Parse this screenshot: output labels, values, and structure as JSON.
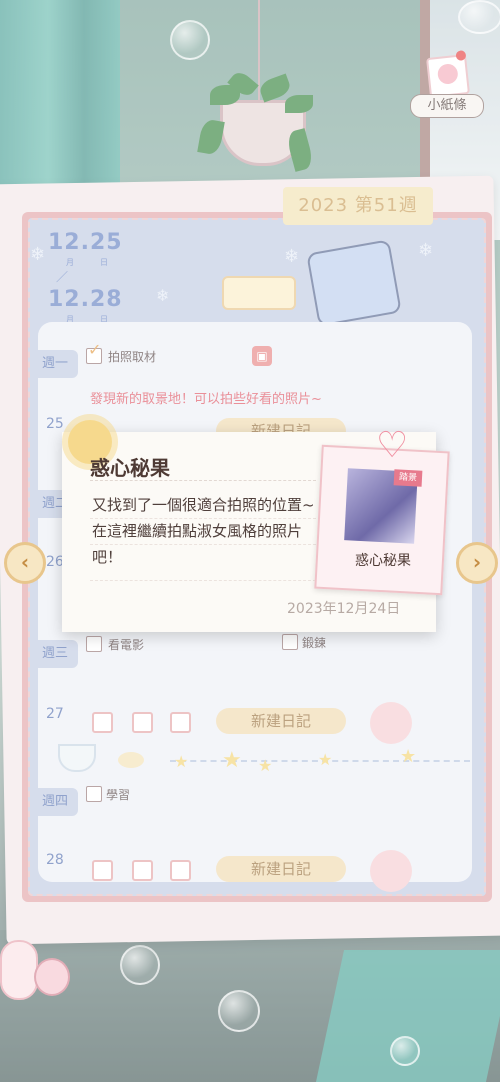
{
  "notes_button": {
    "label": "小紙條"
  },
  "week_tab": "2023 第51週",
  "date_range": {
    "start": "12.25",
    "start_month": "月",
    "start_day": "日",
    "separator": "／",
    "end": "12.28",
    "end_month": "月",
    "end_day": "日"
  },
  "days": [
    {
      "label": "週一",
      "num": "25",
      "tasks": [
        {
          "text": "拍照取材",
          "checked": true
        }
      ],
      "diary_text": "發現新的取景地！可以拍些好看的照片~",
      "new_button": "新建日記"
    },
    {
      "label": "週二",
      "num": "26"
    },
    {
      "label": "週三",
      "num": "27",
      "tasks": [
        {
          "text": "看電影",
          "checked": false
        },
        {
          "text": "鍛鍊",
          "checked": false
        }
      ],
      "new_button": "新建日記"
    },
    {
      "label": "週四",
      "num": "28",
      "tasks": [
        {
          "text": "學習",
          "checked": false
        }
      ],
      "new_button": "新建日記"
    }
  ],
  "popup": {
    "title": "惑心秘果",
    "body": "又找到了一個很適合拍照的位置~在這裡繼續拍點淑女風格的照片吧！",
    "date": "2023年12月24日",
    "card_label": "惑心秘果",
    "card_badge": "踏景"
  },
  "nav": {
    "prev": "‹",
    "next": "›"
  },
  "colors": {
    "accent_pink": "#e4a9ab",
    "accent_blue": "#6b86c4",
    "tab_yellow": "#f2e3b6"
  }
}
